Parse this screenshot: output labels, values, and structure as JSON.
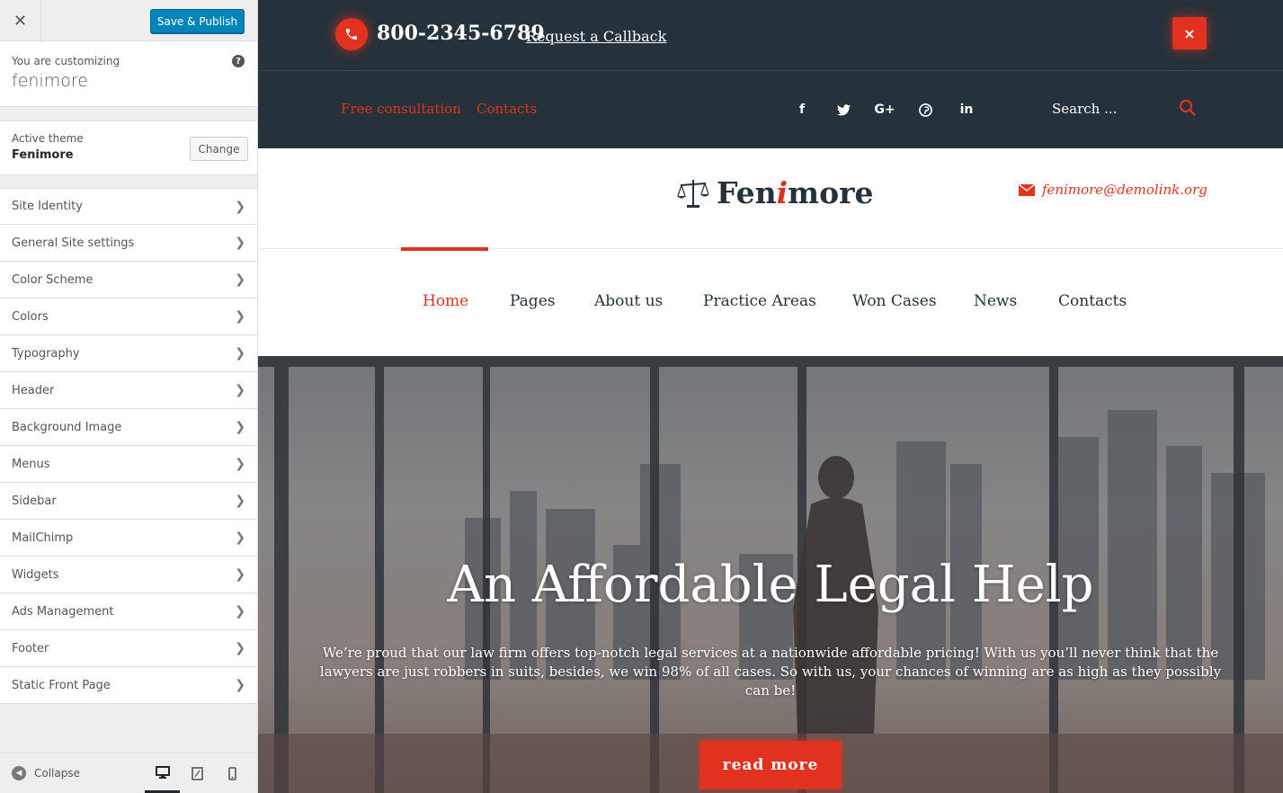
{
  "customizer": {
    "close_label": "✕",
    "save_label": "Save & Publish",
    "customizing_label": "You are customizing",
    "site_name": "fenimore",
    "help_label": "?",
    "active_theme_label": "Active theme",
    "theme_name": "Fenimore",
    "change_label": "Change",
    "sections": [
      {
        "label": "Site Identity"
      },
      {
        "label": "General Site settings"
      },
      {
        "label": "Color Scheme"
      },
      {
        "label": "Colors"
      },
      {
        "label": "Typography"
      },
      {
        "label": "Header"
      },
      {
        "label": "Background Image"
      },
      {
        "label": "Menus"
      },
      {
        "label": "Sidebar"
      },
      {
        "label": "MailChimp"
      },
      {
        "label": "Widgets"
      },
      {
        "label": "Ads Management"
      },
      {
        "label": "Footer"
      },
      {
        "label": "Static Front Page"
      }
    ],
    "collapse_label": "Collapse"
  },
  "site": {
    "phone": "800-2345-6789",
    "callback_label": "Request a Callback",
    "close_label": "×",
    "top_links": [
      "Free consultation",
      "Contacts"
    ],
    "social": [
      "f",
      "t",
      "G+",
      "p",
      "in"
    ],
    "search_placeholder": "Search ...",
    "logo_pre": "Fen",
    "logo_i": "i",
    "logo_post": "more",
    "email": "fenimore@demolink.org",
    "nav": [
      "Home",
      "Pages",
      "About us",
      "Practice Areas",
      "Won Cases",
      "News",
      "Contacts"
    ],
    "hero_title": "An Affordable Legal Help",
    "hero_text": "We’re proud that our law firm offers top-notch legal services at a nationwide affordable pricing! With us you’ll never think that the lawyers are just robbers in suits, besides, we win 98% of all cases. So with us, your chances of winning are as high as they possibly can be!",
    "read_more": "read more"
  },
  "colors": {
    "accent": "#e0321f",
    "dark": "#25313b",
    "wp_blue": "#0085ba"
  }
}
